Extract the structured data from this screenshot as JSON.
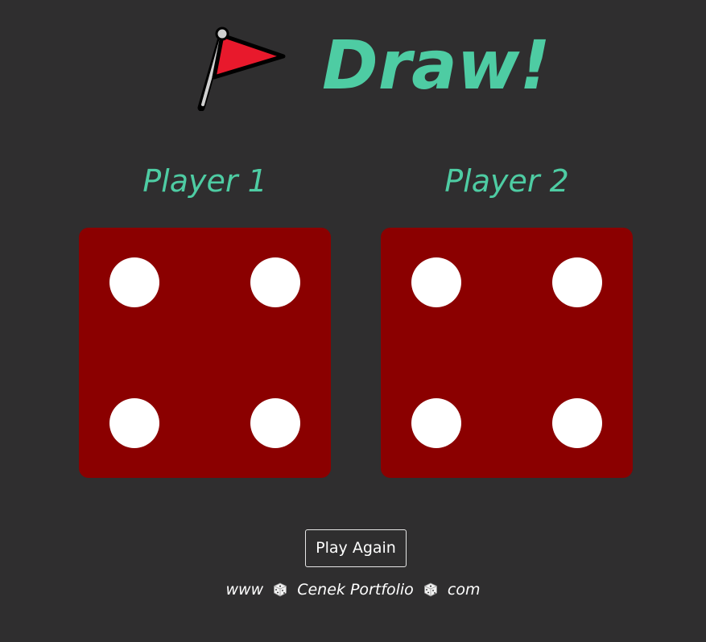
{
  "header": {
    "title": "Draw!",
    "icon": "triangular-flag-icon",
    "title_color": "#4ecca3"
  },
  "players": [
    {
      "label": "Player 1",
      "die_value": 4
    },
    {
      "label": "Player 2",
      "die_value": 4
    }
  ],
  "controls": {
    "play_again_label": "Play Again"
  },
  "footer": {
    "prefix": "www",
    "name": "Cenek Portfolio",
    "suffix": "com",
    "separator_icon": "die-icon"
  },
  "colors": {
    "background": "#2f2e2f",
    "die_face": "#8b0000",
    "pip": "#ffffff",
    "accent": "#4ecca3"
  }
}
